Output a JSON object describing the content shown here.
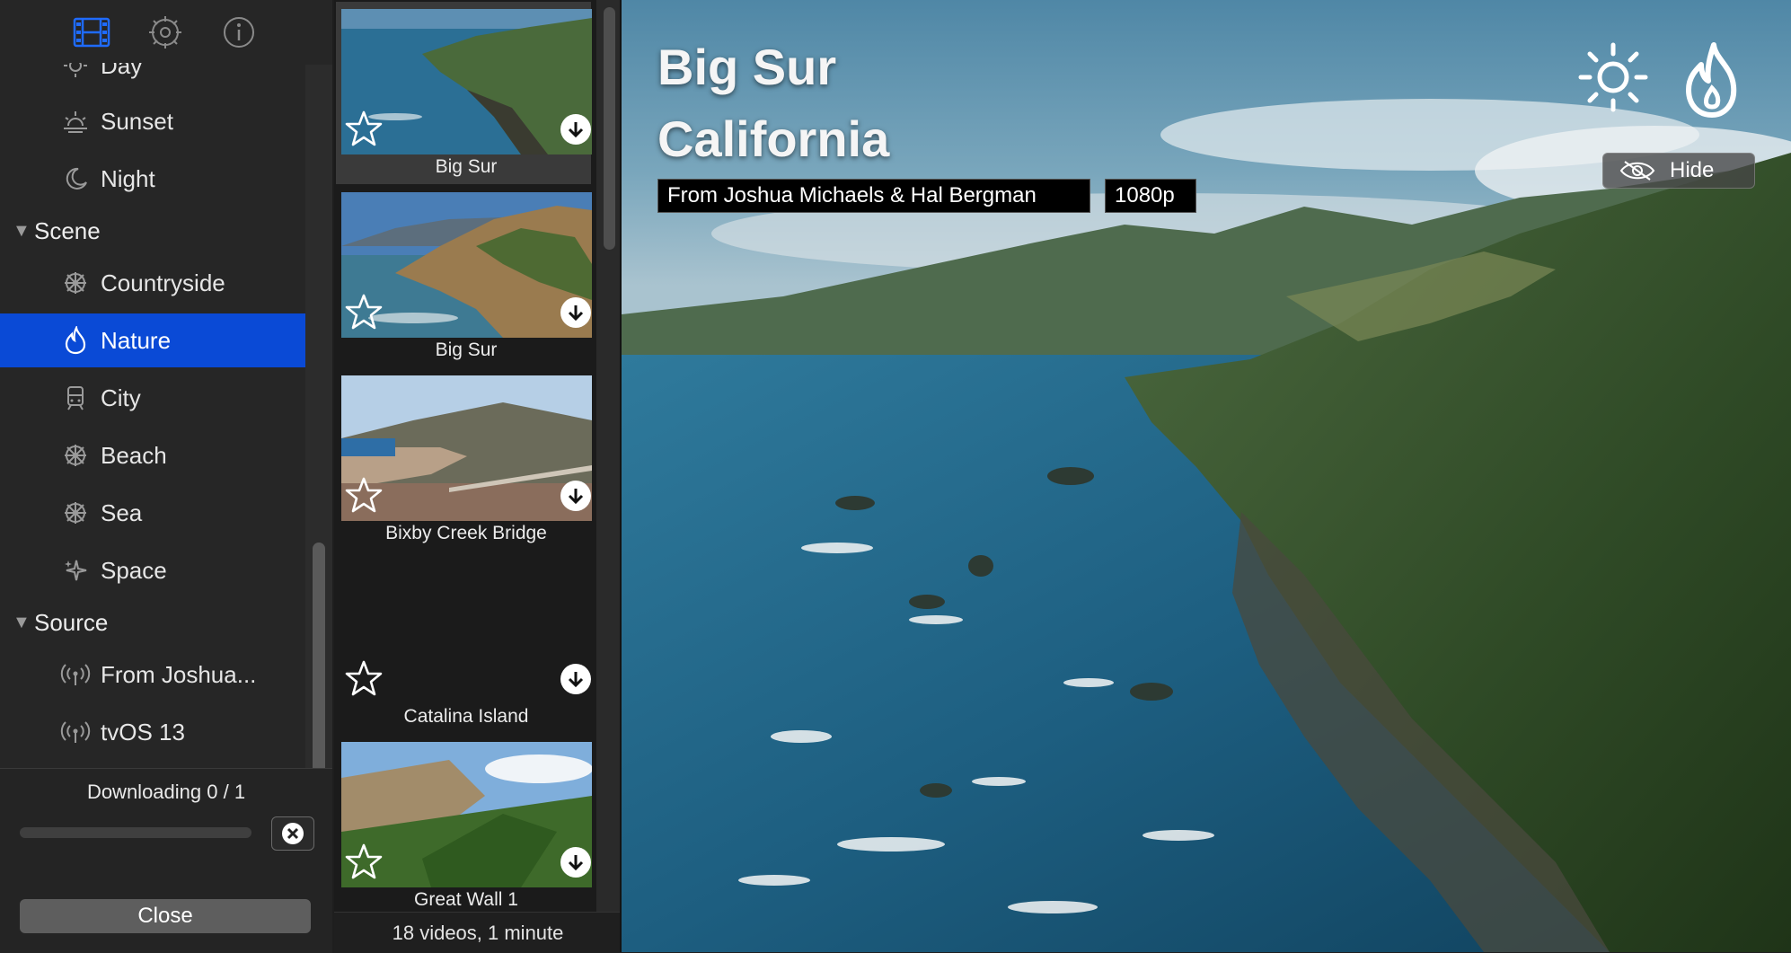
{
  "colors": {
    "accent": "#0a4ad6",
    "sidebar_bg": "#262626",
    "thumb_bg": "#1b1b1b"
  },
  "toolbar": {
    "items": [
      {
        "icon": "film-icon",
        "active": true
      },
      {
        "icon": "gear-icon",
        "active": false
      },
      {
        "icon": "info-icon",
        "active": false
      }
    ]
  },
  "sidebar": {
    "rows": [
      {
        "kind": "sub",
        "label": "Day",
        "icon": "sun-icon"
      },
      {
        "kind": "sub",
        "label": "Sunset",
        "icon": "sunset-icon"
      },
      {
        "kind": "sub",
        "label": "Night",
        "icon": "moon-icon"
      },
      {
        "kind": "group",
        "label": "Scene"
      },
      {
        "kind": "sub",
        "label": "Countryside",
        "icon": "wheel-icon"
      },
      {
        "kind": "sub",
        "label": "Nature",
        "icon": "flame-icon",
        "selected": true
      },
      {
        "kind": "sub",
        "label": "City",
        "icon": "tram-icon"
      },
      {
        "kind": "sub",
        "label": "Beach",
        "icon": "wheel-icon"
      },
      {
        "kind": "sub",
        "label": "Sea",
        "icon": "wheel-icon"
      },
      {
        "kind": "sub",
        "label": "Space",
        "icon": "sparkle-icon"
      },
      {
        "kind": "group",
        "label": "Source"
      },
      {
        "kind": "sub",
        "label": "From Joshua...",
        "icon": "broadcast-icon"
      },
      {
        "kind": "sub",
        "label": "tvOS 13",
        "icon": "broadcast-icon"
      }
    ]
  },
  "download": {
    "status_text": "Downloading 0 / 1",
    "progress": 0,
    "close_label": "Close"
  },
  "thumbnails": {
    "items": [
      {
        "name": "Big Sur",
        "selected": true,
        "scene": "coast"
      },
      {
        "name": "Big Sur",
        "selected": false,
        "scene": "cliffs"
      },
      {
        "name": "Bixby Creek Bridge",
        "selected": false,
        "scene": "bridge"
      },
      {
        "name": "Catalina Island",
        "selected": false,
        "scene": "empty"
      },
      {
        "name": "Great Wall 1",
        "selected": false,
        "scene": "wall"
      }
    ],
    "count_text": "18 videos, 1 minute"
  },
  "preview": {
    "title_line1": "Big Sur",
    "title_line2": "California",
    "credit": "From Joshua Michaels & Hal Bergman",
    "resolution": "1080p",
    "hide_label": "Hide"
  }
}
